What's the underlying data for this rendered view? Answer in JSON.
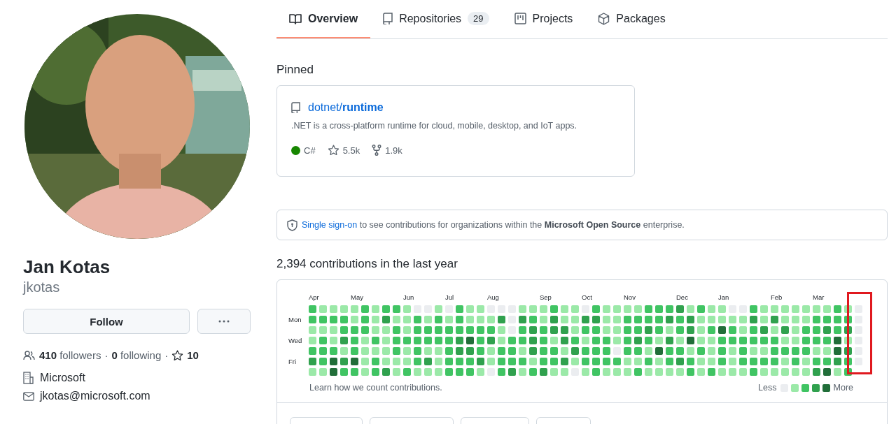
{
  "profile": {
    "name": "Jan Kotas",
    "username": "jkotas",
    "follow_button": "Follow",
    "followers_count": "410",
    "followers_label": "followers",
    "separator": "·",
    "following_count": "0",
    "following_label": "following",
    "starred_count": "10",
    "organization": "Microsoft",
    "email": "jkotas@microsoft.com"
  },
  "tabs": [
    {
      "label": "Overview",
      "selected": true
    },
    {
      "label": "Repositories",
      "count": "29",
      "selected": false
    },
    {
      "label": "Projects",
      "selected": false
    },
    {
      "label": "Packages",
      "selected": false
    }
  ],
  "pinned": {
    "heading": "Pinned",
    "repos": [
      {
        "owner": "dotnet/",
        "name": "runtime",
        "description": ".NET is a cross-platform runtime for cloud, mobile, desktop, and IoT apps.",
        "language": "C#",
        "color": "#178600",
        "star_count": "5.5k",
        "fork_count": "1.9k"
      }
    ]
  },
  "sso_notice": {
    "link": "Single sign-on",
    "text": "to see contributions for organizations within the **Microsoft Open Source** enterprise."
  },
  "contributions": {
    "heading": "2,394 contributions in the last year",
    "months": [
      "Apr",
      "May",
      "Jun",
      "Jul",
      "Aug",
      "Sep",
      "Oct",
      "Nov",
      "Dec",
      "Jan",
      "Feb",
      "Mar"
    ],
    "day_labels": [
      "Mon",
      "Wed",
      "Fri"
    ],
    "weeks": [
      {
        "days": [
          {
            "kind": "mid"
          },
          {
            "kind": "mid"
          },
          {
            "kind": "low"
          },
          {
            "kind": "low"
          },
          {
            "kind": "mid"
          },
          {
            "kind": "high"
          },
          {
            "kind": "low"
          }
        ]
      },
      {
        "days": [
          {
            "kind": "low"
          },
          {
            "kind": "mid"
          },
          {
            "kind": "low"
          },
          {
            "kind": "mid"
          },
          {
            "kind": "mid"
          },
          {
            "kind": "mid"
          },
          {
            "kind": "low"
          }
        ]
      },
      {
        "days": [
          {
            "kind": "low"
          },
          {
            "kind": "mid"
          },
          {
            "kind": "low"
          },
          {
            "kind": "low"
          },
          {
            "kind": "mid"
          },
          {
            "kind": "max"
          },
          {
            "kind": "max"
          }
        ]
      },
      {
        "days": [
          {
            "kind": "low"
          },
          {
            "kind": "mid"
          },
          {
            "kind": "mid"
          },
          {
            "kind": "high"
          },
          {
            "kind": "low"
          },
          {
            "kind": "high"
          },
          {
            "kind": "mid"
          }
        ]
      },
      {
        "days": [
          {
            "kind": "low"
          },
          {
            "kind": "low"
          },
          {
            "kind": "mid"
          },
          {
            "kind": "mid"
          },
          {
            "kind": "mid"
          },
          {
            "kind": "max"
          },
          {
            "kind": "mid"
          }
        ]
      },
      {
        "days": [
          {
            "kind": "mid"
          },
          {
            "kind": "mid"
          },
          {
            "kind": "mid"
          },
          {
            "kind": "low"
          },
          {
            "kind": "low"
          },
          {
            "kind": "low"
          },
          {
            "kind": "low"
          }
        ]
      },
      {
        "days": [
          {
            "kind": "low"
          },
          {
            "kind": "low"
          },
          {
            "kind": "low"
          },
          {
            "kind": "mid"
          },
          {
            "kind": "low"
          },
          {
            "kind": "mid"
          },
          {
            "kind": "mid"
          }
        ]
      },
      {
        "days": [
          {
            "kind": "mid"
          },
          {
            "kind": "high"
          },
          {
            "kind": "low"
          },
          {
            "kind": "low"
          },
          {
            "kind": "low"
          },
          {
            "kind": "low"
          },
          {
            "kind": "high"
          }
        ]
      },
      {
        "days": [
          {
            "kind": "mid"
          },
          {
            "kind": "low"
          },
          {
            "kind": "mid"
          },
          {
            "kind": "mid"
          },
          {
            "kind": "mid"
          },
          {
            "kind": "low"
          },
          {
            "kind": "low"
          }
        ]
      },
      {
        "days": [
          {
            "kind": "low"
          },
          {
            "kind": "low"
          },
          {
            "kind": "low"
          },
          {
            "kind": "mid"
          },
          {
            "kind": "low"
          },
          {
            "kind": "low"
          },
          {
            "kind": "mid"
          }
        ]
      },
      {
        "days": [
          {
            "kind": "none"
          },
          {
            "kind": "mid"
          },
          {
            "kind": "mid"
          },
          {
            "kind": "mid"
          },
          {
            "kind": "mid"
          },
          {
            "kind": "mid"
          },
          {
            "kind": "low"
          }
        ]
      },
      {
        "days": [
          {
            "kind": "none"
          },
          {
            "kind": "low"
          },
          {
            "kind": "mid"
          },
          {
            "kind": "mid"
          },
          {
            "kind": "low"
          },
          {
            "kind": "high"
          },
          {
            "kind": "low"
          }
        ]
      },
      {
        "days": [
          {
            "kind": "low"
          },
          {
            "kind": "mid"
          },
          {
            "kind": "mid"
          },
          {
            "kind": "mid"
          },
          {
            "kind": "low"
          },
          {
            "kind": "low"
          },
          {
            "kind": "low"
          }
        ]
      },
      {
        "days": [
          {
            "kind": "none"
          },
          {
            "kind": "low"
          },
          {
            "kind": "mid"
          },
          {
            "kind": "mid"
          },
          {
            "kind": "mid"
          },
          {
            "kind": "mid"
          },
          {
            "kind": "mid"
          }
        ]
      },
      {
        "days": [
          {
            "kind": "mid"
          },
          {
            "kind": "mid"
          },
          {
            "kind": "mid"
          },
          {
            "kind": "high"
          },
          {
            "kind": "high"
          },
          {
            "kind": "mid"
          },
          {
            "kind": "mid"
          }
        ]
      },
      {
        "days": [
          {
            "kind": "low"
          },
          {
            "kind": "low"
          },
          {
            "kind": "mid"
          },
          {
            "kind": "max"
          },
          {
            "kind": "high"
          },
          {
            "kind": "mid"
          },
          {
            "kind": "mid"
          }
        ]
      },
      {
        "days": [
          {
            "kind": "low"
          },
          {
            "kind": "low"
          },
          {
            "kind": "mid"
          },
          {
            "kind": "mid"
          },
          {
            "kind": "mid"
          },
          {
            "kind": "high"
          },
          {
            "kind": "low"
          }
        ]
      },
      {
        "days": [
          {
            "kind": "none"
          },
          {
            "kind": "low"
          },
          {
            "kind": "mid"
          },
          {
            "kind": "high"
          },
          {
            "kind": "low"
          },
          {
            "kind": "low"
          },
          {
            "kind": "none"
          }
        ]
      },
      {
        "days": [
          {
            "kind": "none"
          },
          {
            "kind": "high"
          },
          {
            "kind": "low"
          },
          {
            "kind": "low"
          },
          {
            "kind": "mid"
          },
          {
            "kind": "mid"
          },
          {
            "kind": "mid"
          }
        ]
      },
      {
        "days": [
          {
            "kind": "none"
          },
          {
            "kind": "none"
          },
          {
            "kind": "none"
          },
          {
            "kind": "mid"
          },
          {
            "kind": "mid"
          },
          {
            "kind": "mid"
          },
          {
            "kind": "high"
          }
        ]
      },
      {
        "days": [
          {
            "kind": "low"
          },
          {
            "kind": "high"
          },
          {
            "kind": "mid"
          },
          {
            "kind": "mid"
          },
          {
            "kind": "low"
          },
          {
            "kind": "mid"
          },
          {
            "kind": "low"
          }
        ]
      },
      {
        "days": [
          {
            "kind": "low"
          },
          {
            "kind": "mid"
          },
          {
            "kind": "high"
          },
          {
            "kind": "high"
          },
          {
            "kind": "high"
          },
          {
            "kind": "low"
          },
          {
            "kind": "mid"
          }
        ]
      },
      {
        "days": [
          {
            "kind": "low"
          },
          {
            "kind": "low"
          },
          {
            "kind": "mid"
          },
          {
            "kind": "mid"
          },
          {
            "kind": "mid"
          },
          {
            "kind": "mid"
          },
          {
            "kind": "high"
          }
        ]
      },
      {
        "days": [
          {
            "kind": "mid"
          },
          {
            "kind": "high"
          },
          {
            "kind": "high"
          },
          {
            "kind": "low"
          },
          {
            "kind": "mid"
          },
          {
            "kind": "mid"
          },
          {
            "kind": "low"
          }
        ]
      },
      {
        "days": [
          {
            "kind": "low"
          },
          {
            "kind": "low"
          },
          {
            "kind": "high"
          },
          {
            "kind": "high"
          },
          {
            "kind": "low"
          },
          {
            "kind": "high"
          },
          {
            "kind": "low"
          }
        ]
      },
      {
        "days": [
          {
            "kind": "low"
          },
          {
            "kind": "low"
          },
          {
            "kind": "low"
          },
          {
            "kind": "mid"
          },
          {
            "kind": "high"
          },
          {
            "kind": "low"
          },
          {
            "kind": "none"
          }
        ]
      },
      {
        "days": [
          {
            "kind": "none"
          },
          {
            "kind": "high"
          },
          {
            "kind": "mid"
          },
          {
            "kind": "low"
          },
          {
            "kind": "mid"
          },
          {
            "kind": "mid"
          },
          {
            "kind": "low"
          }
        ]
      },
      {
        "days": [
          {
            "kind": "mid"
          },
          {
            "kind": "high"
          },
          {
            "kind": "mid"
          },
          {
            "kind": "mid"
          },
          {
            "kind": "mid"
          },
          {
            "kind": "mid"
          },
          {
            "kind": "mid"
          }
        ]
      },
      {
        "days": [
          {
            "kind": "low"
          },
          {
            "kind": "low"
          },
          {
            "kind": "low"
          },
          {
            "kind": "mid"
          },
          {
            "kind": "mid"
          },
          {
            "kind": "mid"
          },
          {
            "kind": "low"
          }
        ]
      },
      {
        "days": [
          {
            "kind": "low"
          },
          {
            "kind": "low"
          },
          {
            "kind": "low"
          },
          {
            "kind": "low"
          },
          {
            "kind": "none"
          },
          {
            "kind": "mid"
          },
          {
            "kind": "low"
          }
        ]
      },
      {
        "days": [
          {
            "kind": "low"
          },
          {
            "kind": "mid"
          },
          {
            "kind": "mid"
          },
          {
            "kind": "mid"
          },
          {
            "kind": "mid"
          },
          {
            "kind": "low"
          },
          {
            "kind": "low"
          }
        ]
      },
      {
        "days": [
          {
            "kind": "low"
          },
          {
            "kind": "mid"
          },
          {
            "kind": "mid"
          },
          {
            "kind": "high"
          },
          {
            "kind": "mid"
          },
          {
            "kind": "low"
          },
          {
            "kind": "mid"
          }
        ]
      },
      {
        "days": [
          {
            "kind": "mid"
          },
          {
            "kind": "mid"
          },
          {
            "kind": "high"
          },
          {
            "kind": "mid"
          },
          {
            "kind": "low"
          },
          {
            "kind": "mid"
          },
          {
            "kind": "low"
          }
        ]
      },
      {
        "days": [
          {
            "kind": "mid"
          },
          {
            "kind": "mid"
          },
          {
            "kind": "mid"
          },
          {
            "kind": "low"
          },
          {
            "kind": "max"
          },
          {
            "kind": "low"
          },
          {
            "kind": "low"
          }
        ]
      },
      {
        "days": [
          {
            "kind": "mid"
          },
          {
            "kind": "high"
          },
          {
            "kind": "low"
          },
          {
            "kind": "high"
          },
          {
            "kind": "mid"
          },
          {
            "kind": "mid"
          },
          {
            "kind": "low"
          }
        ]
      },
      {
        "days": [
          {
            "kind": "high"
          },
          {
            "kind": "mid"
          },
          {
            "kind": "mid"
          },
          {
            "kind": "low"
          },
          {
            "kind": "mid"
          },
          {
            "kind": "high"
          },
          {
            "kind": "low"
          }
        ]
      },
      {
        "days": [
          {
            "kind": "low"
          },
          {
            "kind": "high"
          },
          {
            "kind": "high"
          },
          {
            "kind": "max"
          },
          {
            "kind": "low"
          },
          {
            "kind": "mid"
          },
          {
            "kind": "mid"
          }
        ]
      },
      {
        "days": [
          {
            "kind": "mid"
          },
          {
            "kind": "low"
          },
          {
            "kind": "low"
          },
          {
            "kind": "low"
          },
          {
            "kind": "mid"
          },
          {
            "kind": "low"
          },
          {
            "kind": "low"
          }
        ]
      },
      {
        "days": [
          {
            "kind": "low"
          },
          {
            "kind": "low"
          },
          {
            "kind": "mid"
          },
          {
            "kind": "low"
          },
          {
            "kind": "low"
          },
          {
            "kind": "low"
          },
          {
            "kind": "mid"
          }
        ]
      },
      {
        "days": [
          {
            "kind": "low"
          },
          {
            "kind": "low"
          },
          {
            "kind": "max"
          },
          {
            "kind": "mid"
          },
          {
            "kind": "mid"
          },
          {
            "kind": "mid"
          },
          {
            "kind": "low"
          }
        ]
      },
      {
        "days": [
          {
            "kind": "none"
          },
          {
            "kind": "low"
          },
          {
            "kind": "mid"
          },
          {
            "kind": "mid"
          },
          {
            "kind": "low"
          },
          {
            "kind": "low"
          },
          {
            "kind": "low"
          }
        ]
      },
      {
        "days": [
          {
            "kind": "none"
          },
          {
            "kind": "low"
          },
          {
            "kind": "low"
          },
          {
            "kind": "mid"
          },
          {
            "kind": "mid"
          },
          {
            "kind": "mid"
          },
          {
            "kind": "low"
          }
        ]
      },
      {
        "days": [
          {
            "kind": "mid"
          },
          {
            "kind": "high"
          },
          {
            "kind": "mid"
          },
          {
            "kind": "mid"
          },
          {
            "kind": "low"
          },
          {
            "kind": "mid"
          },
          {
            "kind": "mid"
          }
        ]
      },
      {
        "days": [
          {
            "kind": "low"
          },
          {
            "kind": "low"
          },
          {
            "kind": "high"
          },
          {
            "kind": "mid"
          },
          {
            "kind": "low"
          },
          {
            "kind": "mid"
          },
          {
            "kind": "low"
          }
        ]
      },
      {
        "days": [
          {
            "kind": "low"
          },
          {
            "kind": "high"
          },
          {
            "kind": "low"
          },
          {
            "kind": "mid"
          },
          {
            "kind": "mid"
          },
          {
            "kind": "mid"
          },
          {
            "kind": "low"
          }
        ]
      },
      {
        "days": [
          {
            "kind": "low"
          },
          {
            "kind": "low"
          },
          {
            "kind": "high"
          },
          {
            "kind": "low"
          },
          {
            "kind": "mid"
          },
          {
            "kind": "low"
          },
          {
            "kind": "low"
          }
        ]
      },
      {
        "days": [
          {
            "kind": "low"
          },
          {
            "kind": "low"
          },
          {
            "kind": "low"
          },
          {
            "kind": "low"
          },
          {
            "kind": "mid"
          },
          {
            "kind": "mid"
          },
          {
            "kind": "low"
          }
        ]
      },
      {
        "days": [
          {
            "kind": "low"
          },
          {
            "kind": "low"
          },
          {
            "kind": "mid"
          },
          {
            "kind": "mid"
          },
          {
            "kind": "mid"
          },
          {
            "kind": "low"
          },
          {
            "kind": "low"
          }
        ]
      },
      {
        "days": [
          {
            "kind": "low"
          },
          {
            "kind": "mid"
          },
          {
            "kind": "mid"
          },
          {
            "kind": "mid"
          },
          {
            "kind": "low"
          },
          {
            "kind": "mid"
          },
          {
            "kind": "high"
          }
        ]
      },
      {
        "days": [
          {
            "kind": "low"
          },
          {
            "kind": "mid"
          },
          {
            "kind": "high"
          },
          {
            "kind": "mid"
          },
          {
            "kind": "low"
          },
          {
            "kind": "mid"
          },
          {
            "kind": "max"
          }
        ]
      },
      {
        "days": [
          {
            "kind": "mid"
          },
          {
            "kind": "mid"
          },
          {
            "kind": "mid"
          },
          {
            "kind": "max"
          },
          {
            "kind": "max"
          },
          {
            "kind": "high"
          },
          {
            "kind": "low"
          }
        ]
      },
      {
        "days": [
          {
            "kind": "low"
          },
          {
            "kind": "mid"
          },
          {
            "kind": "high"
          },
          {
            "kind": "low"
          },
          {
            "kind": "high"
          },
          {
            "kind": "mid"
          },
          {
            "kind": "mid"
          }
        ]
      },
      {
        "days": [
          {
            "kind": "none"
          },
          {
            "kind": "none"
          },
          {
            "kind": "none"
          },
          {
            "kind": "none"
          },
          {
            "kind": "none"
          },
          {
            "kind": "none"
          }
        ]
      }
    ],
    "learn_link": "Learn how we count contributions.",
    "legend_less": "Less",
    "legend_more": "More",
    "highlight_last_week": true
  }
}
